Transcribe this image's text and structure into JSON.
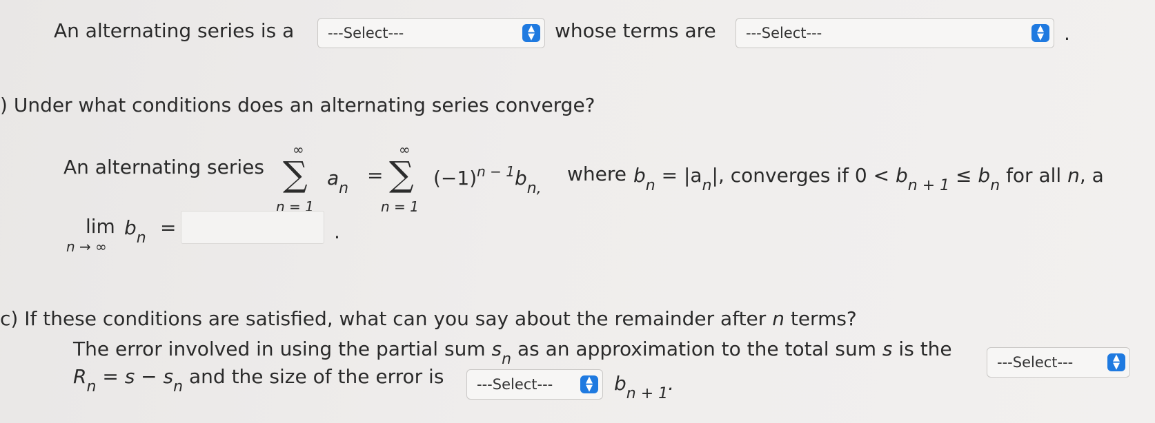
{
  "part_a": {
    "text_before": "An alternating series is a",
    "select1": "---Select---",
    "text_middle": "whose terms are",
    "select2": "---Select---",
    "end": "."
  },
  "part_b": {
    "question": ") Under what conditions does an alternating series converge?",
    "lead": "An alternating series",
    "sum_top": "∞",
    "sum_bottom": "n = 1",
    "sigma": "∑",
    "a_n": "a",
    "n": "n",
    "equals": "=",
    "term_base": "(−1)",
    "term_exp": "n − 1",
    "b": "b",
    "n_comma": "n,",
    "where_text": "where",
    "abs_text": "= |a",
    "abs_close": "|, converges if 0 <",
    "np1": "n + 1",
    "le": "≤",
    "tail": "for all",
    "tail2": ", a",
    "lim": "lim",
    "lim_sub": "n → ∞",
    "period": ".",
    "answer_value": ""
  },
  "part_c": {
    "question": "c) If these conditions are satisfied, what can you say about the remainder after",
    "question_n": "n",
    "question_tail": "terms?",
    "line1": "The error involved in using the partial sum",
    "s": "s",
    "line1b": "as an approximation to the total sum",
    "line1c": "is the",
    "select1": "---Select---",
    "R": "R",
    "line2a": "= s − s",
    "line2b": "and the size of the error is",
    "select2": "---Select---",
    "b": "b",
    "np1": "n + 1",
    "end": "."
  },
  "colors": {
    "accent": "#1f7ae0",
    "text": "#2a2a2a",
    "background": "#efedec"
  }
}
